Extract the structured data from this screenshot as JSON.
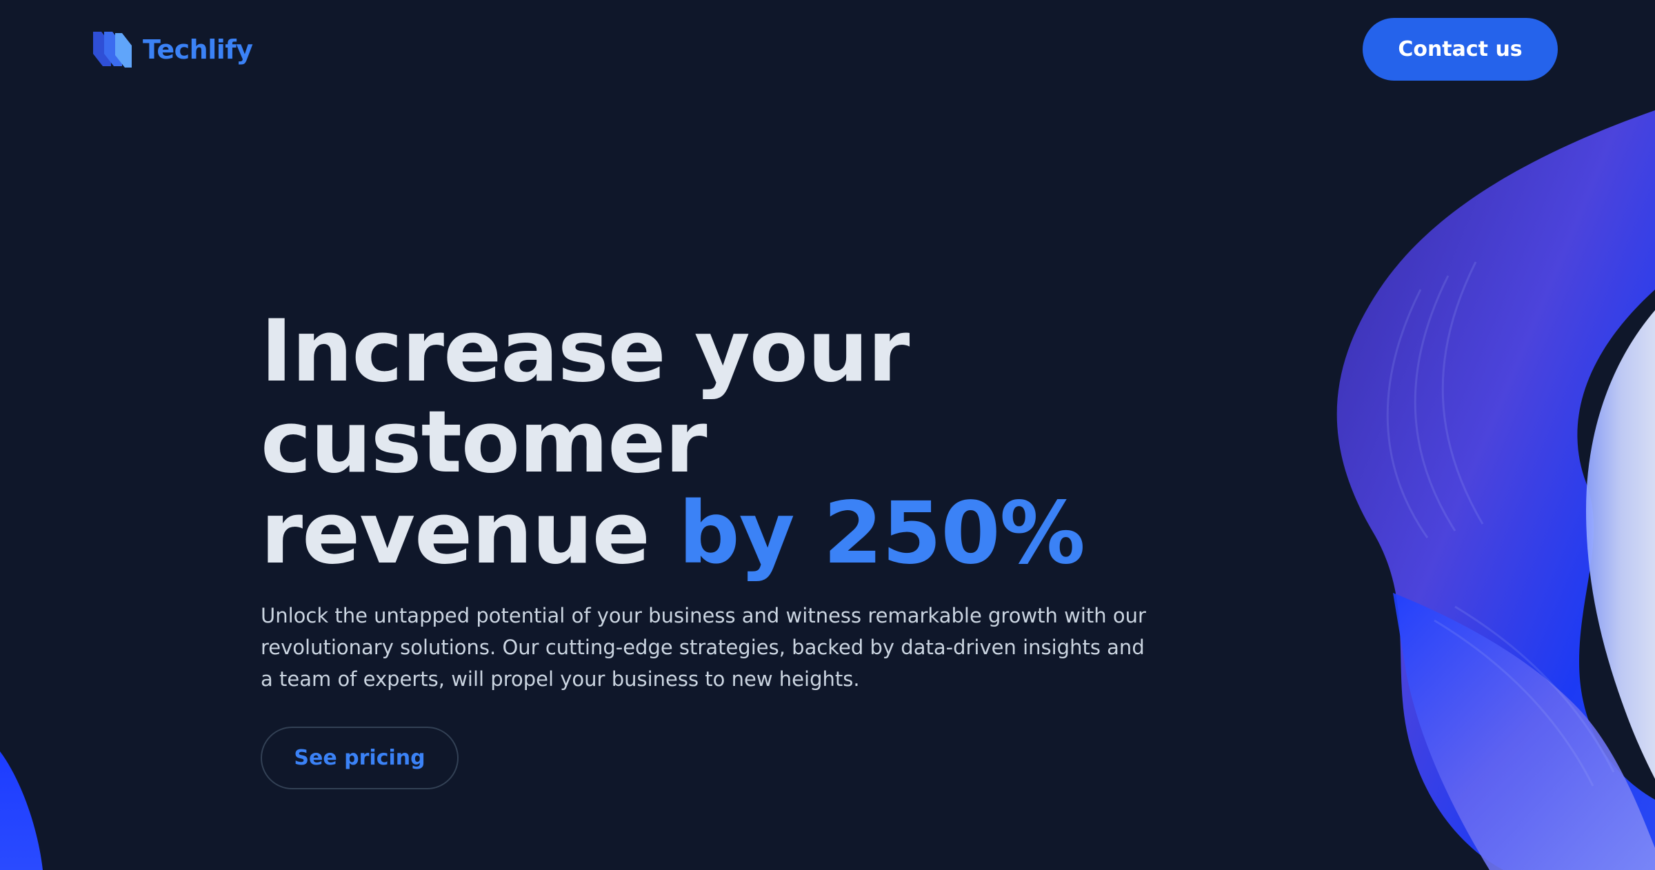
{
  "header": {
    "brand": "Techlify",
    "contact_label": "Contact us"
  },
  "hero": {
    "title_line1": "Increase your customer",
    "title_line2_prefix": "revenue ",
    "title_line2_accent": "by 250%",
    "description": "Unlock the untapped potential of your business and witness remarkable growth with our revolutionary solutions. Our cutting-edge strategies, backed by data-driven insights and a team of experts, will propel your business to new heights.",
    "cta_label": "See pricing"
  },
  "icons": {
    "logo": "techlify-logo-icon"
  },
  "colors": {
    "background": "#0f172a",
    "accent": "#3b82f6",
    "primary_button": "#2563eb",
    "heading": "#e2e8f0",
    "body_text": "#cbd5e1"
  }
}
